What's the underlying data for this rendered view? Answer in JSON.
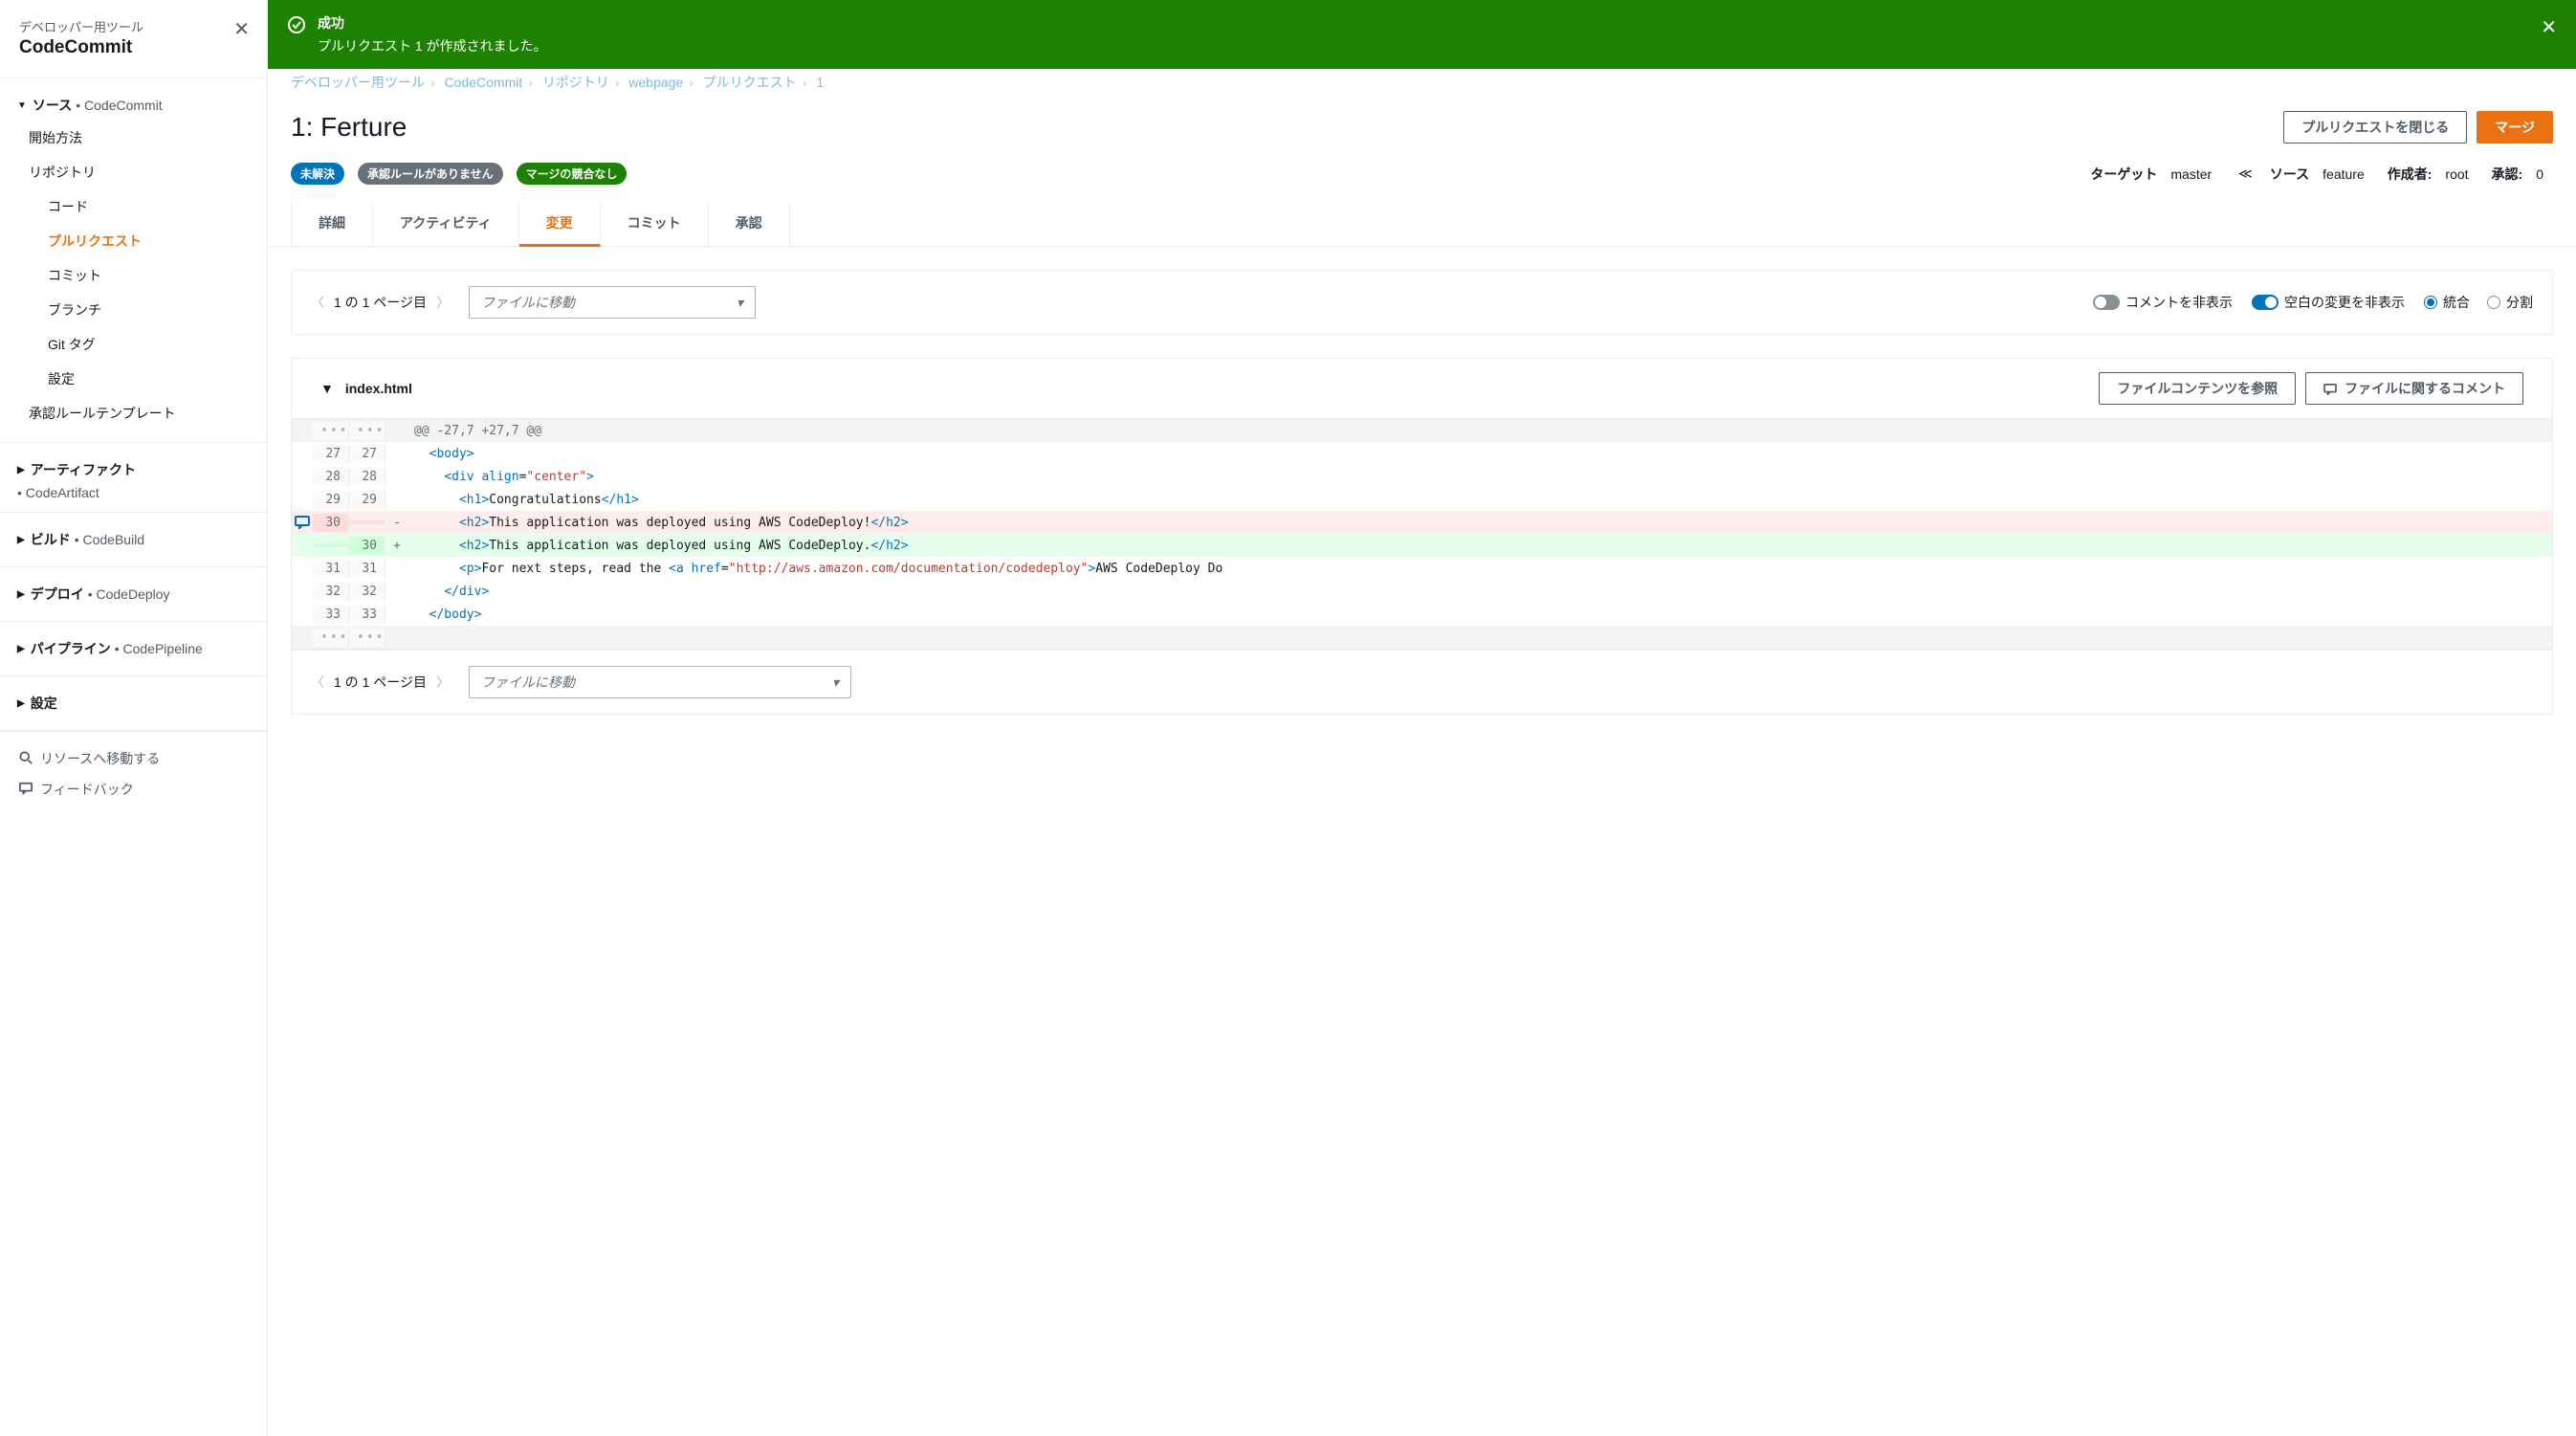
{
  "sidebar": {
    "subtitle": "デベロッパー用ツール",
    "title": "CodeCommit",
    "sections": [
      {
        "label": "ソース",
        "service": "• CodeCommit",
        "items": [
          {
            "label": "開始方法",
            "sub": false
          },
          {
            "label": "リポジトリ",
            "sub": false,
            "children": [
              {
                "label": "コード"
              },
              {
                "label": "プルリクエスト",
                "active": true
              },
              {
                "label": "コミット"
              },
              {
                "label": "ブランチ"
              },
              {
                "label": "Git タグ"
              },
              {
                "label": "設定"
              }
            ]
          },
          {
            "label": "承認ルールテンプレート",
            "sub": false
          }
        ]
      },
      {
        "label": "アーティファクト",
        "service": "",
        "items": [
          {
            "label": "• CodeArtifact",
            "svc": true
          }
        ]
      },
      {
        "label": "ビルド",
        "service": "• CodeBuild",
        "items": []
      },
      {
        "label": "デプロイ",
        "service": "• CodeDeploy",
        "items": []
      },
      {
        "label": "パイプライン",
        "service": "• CodePipeline",
        "items": []
      },
      {
        "label": "設定",
        "service": "",
        "items": []
      }
    ],
    "footer": {
      "goto": "リソースへ移動する",
      "feedback": "フィードバック"
    }
  },
  "banner": {
    "title": "成功",
    "msg": "プルリクエスト 1 が作成されました。"
  },
  "breadcrumb": {
    "items": [
      "デベロッパー用ツール",
      "CodeCommit",
      "リポジトリ",
      "webpage",
      "プルリクエスト"
    ],
    "current": "1"
  },
  "page": {
    "title": "1: Ferture",
    "close_btn": "プルリクエストを閉じる",
    "merge_btn": "マージ"
  },
  "status": {
    "badge1": "未解決",
    "badge2": "承認ルールがありません",
    "badge3": "マージの競合なし",
    "target_label": "ターゲット",
    "target_val": "master",
    "source_label": "ソース",
    "source_val": "feature",
    "author_label": "作成者:",
    "author_val": "root",
    "approval_label": "承認:",
    "approval_val": "0"
  },
  "tabs": {
    "detail": "詳細",
    "activity": "アクティビティ",
    "changes": "変更",
    "commit": "コミット",
    "approval": "承認"
  },
  "toolbar": {
    "pager": "1 の 1 ページ目",
    "file_placeholder": "ファイルに移動",
    "hide_comments": "コメントを非表示",
    "hide_whitespace": "空白の変更を非表示",
    "unified": "統合",
    "split": "分割"
  },
  "diff": {
    "filename": "index.html",
    "view_contents": "ファイルコンテンツを参照",
    "file_comment": "ファイルに関するコメント",
    "hunk": "@@ -27,7 +27,7 @@",
    "lines": [
      {
        "l": "27",
        "r": "27",
        "s": "",
        "code_html": "  <span class='tag'>&lt;body&gt;</span>"
      },
      {
        "l": "28",
        "r": "28",
        "s": "",
        "code_html": "    <span class='tag'>&lt;div</span> <span class='attr'>align</span>=<span class='val'>\"center\"</span><span class='tag'>&gt;</span>"
      },
      {
        "l": "29",
        "r": "29",
        "s": "",
        "code_html": "      <span class='tag'>&lt;h1&gt;</span>Congratulations<span class='tag'>&lt;/h1&gt;</span>"
      },
      {
        "l": "30",
        "r": "",
        "s": "-",
        "type": "del",
        "comment": true,
        "code_html": "      <span class='tag'>&lt;h2&gt;</span>This application was deployed using AWS CodeDeploy!<span class='tag'>&lt;/h2&gt;</span>"
      },
      {
        "l": "",
        "r": "30",
        "s": "+",
        "type": "add",
        "code_html": "      <span class='tag'>&lt;h2&gt;</span>This application was deployed using AWS CodeDeploy.<span class='tag'>&lt;/h2&gt;</span>"
      },
      {
        "l": "31",
        "r": "31",
        "s": "",
        "code_html": "      <span class='tag'>&lt;p&gt;</span>For next steps, read the <span class='tag'>&lt;a</span> <span class='attr'>href</span>=<span class='str'>\"http://aws.amazon.com/documentation/codedeploy\"</span><span class='tag'>&gt;</span>AWS CodeDeploy Do"
      },
      {
        "l": "32",
        "r": "32",
        "s": "",
        "code_html": "    <span class='tag'>&lt;/div&gt;</span>"
      },
      {
        "l": "33",
        "r": "33",
        "s": "",
        "code_html": "  <span class='tag'>&lt;/body&gt;</span>"
      }
    ]
  }
}
